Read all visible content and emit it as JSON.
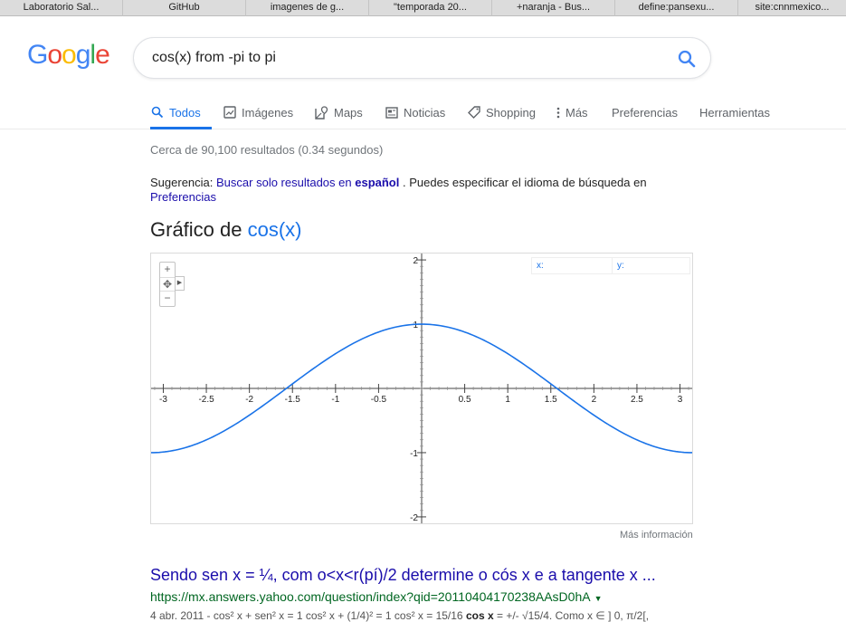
{
  "bookmarks": [
    "Laboratorio Sal...",
    "GitHub",
    "imagenes de g...",
    "\"temporada 20...",
    "+naranja - Bus...",
    "define:pansexu...",
    "site:cnnmexico..."
  ],
  "search": {
    "query": "cos(x) from -pi to pi"
  },
  "logo": {
    "letters": [
      "G",
      "o",
      "o",
      "g",
      "l",
      "e"
    ],
    "colors": [
      "#4285f4",
      "#ea4335",
      "#fbbc05",
      "#4285f4",
      "#34a853",
      "#ea4335"
    ]
  },
  "tabs": [
    {
      "label": "Todos",
      "icon": "search-icon",
      "active": true
    },
    {
      "label": "Imágenes",
      "icon": "image-icon"
    },
    {
      "label": "Maps",
      "icon": "map-icon"
    },
    {
      "label": "Noticias",
      "icon": "news-icon"
    },
    {
      "label": "Shopping",
      "icon": "tag-icon"
    },
    {
      "label": "Más",
      "icon": "more-vert-icon"
    },
    {
      "label": "Preferencias"
    },
    {
      "label": "Herramientas"
    }
  ],
  "stats": "Cerca de 90,100 resultados (0.34 segundos)",
  "suggestion": {
    "prefix": "Sugerencia:",
    "link_text": "Buscar solo resultados en",
    "link_bold": "español",
    "middle": ". Puedes especificar el idioma de búsqueda en",
    "pref_link": "Preferencias"
  },
  "graph": {
    "title_prefix": "Gráfico de",
    "function": "cos(x)",
    "readout_x": "x:",
    "readout_y": "y:",
    "more_info": "Más información",
    "zoom_in": "+",
    "pan": "✥",
    "zoom_out": "−"
  },
  "chart_data": {
    "type": "line",
    "function": "cos(x)",
    "xlim": [
      -3.1416,
      3.1416
    ],
    "ylim": [
      -2.1,
      2.1
    ],
    "x_ticks": [
      -3,
      -2.5,
      -2,
      -1.5,
      -1,
      -0.5,
      0.5,
      1,
      1.5,
      2,
      2.5,
      3
    ],
    "x_tick_labels": [
      "-3",
      "-2.5",
      "-2",
      "-1.5",
      "-1",
      "-0.5",
      "0.5",
      "1",
      "1.5",
      "2",
      "2.5",
      "3"
    ],
    "y_ticks": [
      2,
      1,
      -1,
      -2
    ],
    "y_tick_labels": [
      "2",
      "1",
      "-1",
      "-2"
    ],
    "series": [
      {
        "color": "#1a73e8",
        "x": [
          -3.14,
          -2.9,
          -2.6,
          -2.3,
          -2.0,
          -1.7,
          -1.4,
          -1.1,
          -0.8,
          -0.5,
          -0.2,
          0,
          0.2,
          0.5,
          0.8,
          1.1,
          1.4,
          1.7,
          2.0,
          2.3,
          2.6,
          2.9,
          3.14
        ],
        "y": [
          -1.0,
          -0.971,
          -0.857,
          -0.666,
          -0.416,
          -0.129,
          0.17,
          0.454,
          0.697,
          0.878,
          0.98,
          1.0,
          0.98,
          0.878,
          0.697,
          0.454,
          0.17,
          -0.129,
          -0.416,
          -0.666,
          -0.857,
          -0.971,
          -1.0
        ]
      }
    ]
  },
  "result": {
    "title": "Sendo sen x = ¼, com o<x<r(pí)/2 determine o cós x e a tangente x ...",
    "url": "https://mx.answers.yahoo.com/question/index?qid=20110404170238AAsD0hA",
    "snippet_pre": "4 abr. 2011 - cos² x + sen² x = 1 cos² x + (1/4)² = 1 cos² x = 15/16 ",
    "snippet_bold": "cos x",
    "snippet_post": " = +/- √15/4. Como x ∈ ] 0, π/2[,"
  }
}
